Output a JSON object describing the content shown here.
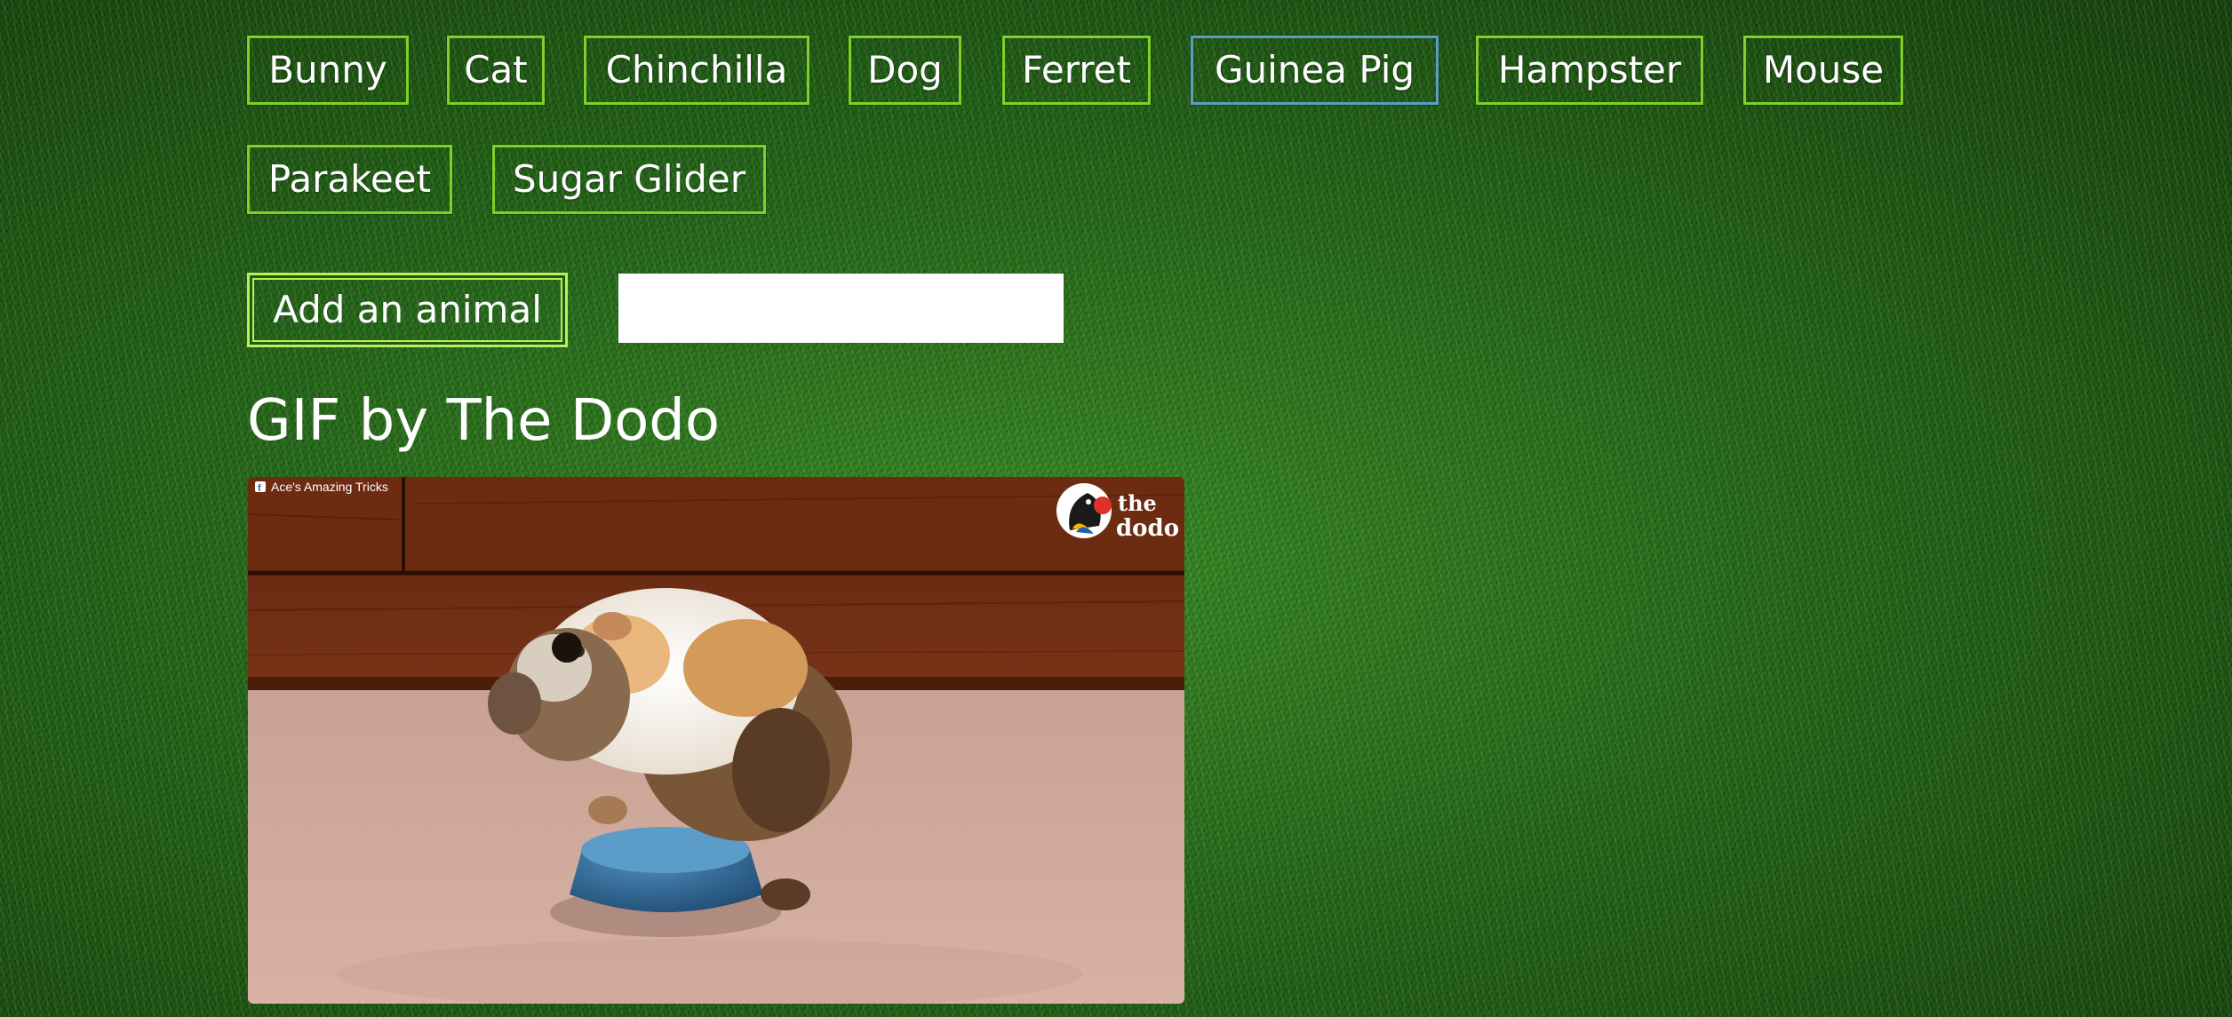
{
  "animals": [
    {
      "label": "Bunny"
    },
    {
      "label": "Cat"
    },
    {
      "label": "Chinchilla"
    },
    {
      "label": "Dog"
    },
    {
      "label": "Ferret"
    },
    {
      "label": "Guinea Pig"
    },
    {
      "label": "Hampster"
    },
    {
      "label": "Mouse"
    },
    {
      "label": "Parakeet"
    },
    {
      "label": "Sugar Glider"
    }
  ],
  "selected_animal": "Guinea Pig",
  "add_animal": {
    "button_label": "Add an animal",
    "input_value": "",
    "input_placeholder": ""
  },
  "gif": {
    "title": "GIF by The Dodo",
    "source_caption": "Ace's Amazing Tricks",
    "logo_text_top": "the",
    "logo_text_bottom": "dodo",
    "source_icon": "facebook-icon"
  },
  "colors": {
    "button_border": "#7fd12a",
    "selected_border": "#5a9ec4",
    "background": "#1f5a12"
  }
}
